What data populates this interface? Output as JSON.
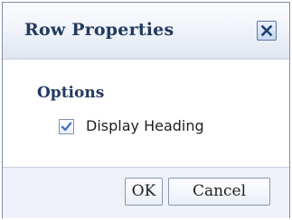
{
  "dialog": {
    "title": "Row Properties",
    "close_icon": "close-icon",
    "section_title": "Options",
    "options": [
      {
        "label": "Display Heading",
        "checked": true,
        "icon": "checkmark-icon"
      }
    ],
    "buttons": {
      "ok_label": "OK",
      "cancel_label": "Cancel"
    }
  },
  "colors": {
    "title_text": "#233a5f",
    "border": "#7e8da8",
    "footer_bg": "#eef2f8",
    "checkmark": "#3d6fbf"
  }
}
